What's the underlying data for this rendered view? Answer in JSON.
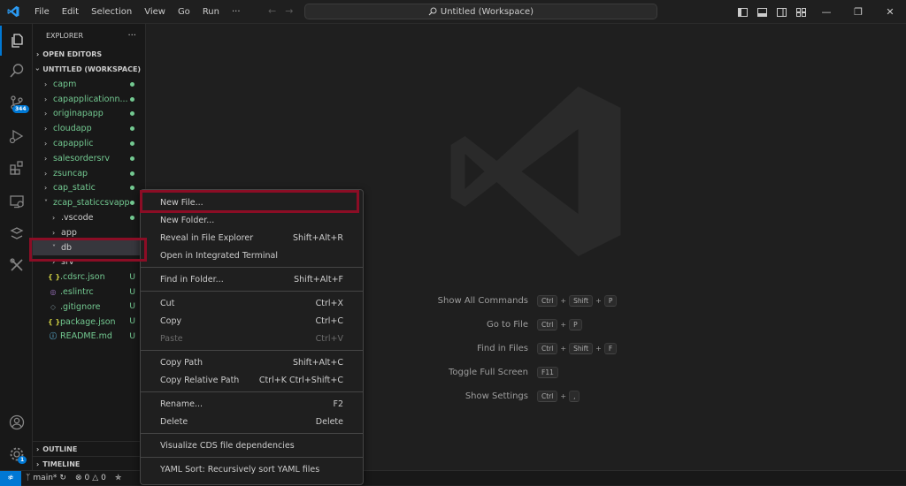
{
  "titlebar": {
    "menus": [
      "File",
      "Edit",
      "Selection",
      "View",
      "Go",
      "Run",
      "···"
    ],
    "command_center": "Untitled (Workspace)",
    "icons": [
      "toggle-primary-sidebar-icon",
      "toggle-panel-icon",
      "toggle-secondary-sidebar-icon",
      "customize-layout-icon"
    ]
  },
  "activitybar": {
    "items": [
      "explorer-icon",
      "search-icon",
      "source-control-icon",
      "run-debug-icon",
      "extensions-icon",
      "remote-explorer-icon",
      "sap-fiori-icon",
      "tools-icon"
    ],
    "scm_badge": "344",
    "account": "account-icon",
    "manage": "gear-icon",
    "manage_badge": "1"
  },
  "sidebar": {
    "title": "EXPLORER",
    "more": "···",
    "open_editors": "OPEN EDITORS",
    "workspace": "UNTITLED (WORKSPACE)",
    "folders": [
      "capm",
      "capapplicationn...",
      "originapapp",
      "cloudapp",
      "capapplic",
      "salesordersrv",
      "zsuncap",
      "cap_static",
      "zcap_staticcsvapp"
    ],
    "children": [
      {
        "name": ".vscode",
        "type": "folder"
      },
      {
        "name": "app",
        "type": "folder"
      },
      {
        "name": "db",
        "type": "folder-open"
      },
      {
        "name": "srv",
        "type": "folder"
      }
    ],
    "files": [
      {
        "name": ".cdsrc.json",
        "icon": "{ }",
        "status": "U"
      },
      {
        "name": ".eslintrc",
        "icon": "◎",
        "status": "U"
      },
      {
        "name": ".gitignore",
        "icon": "◇",
        "status": "U"
      },
      {
        "name": "package.json",
        "icon": "{ }",
        "status": "U"
      },
      {
        "name": "README.md",
        "icon": "ⓘ",
        "status": "U"
      }
    ],
    "outline": "OUTLINE",
    "timeline": "TIMELINE"
  },
  "editor": {
    "shortcuts": [
      {
        "label": "Show All Commands",
        "keys": [
          "Ctrl",
          "+",
          "Shift",
          "+",
          "P"
        ]
      },
      {
        "label": "Go to File",
        "keys": [
          "Ctrl",
          "+",
          "P"
        ]
      },
      {
        "label": "Find in Files",
        "keys": [
          "Ctrl",
          "+",
          "Shift",
          "+",
          "F"
        ]
      },
      {
        "label": "Toggle Full Screen",
        "keys": [
          "F11"
        ]
      },
      {
        "label": "Show Settings",
        "keys": [
          "Ctrl",
          "+",
          ","
        ]
      }
    ]
  },
  "context_menu": {
    "groups": [
      [
        {
          "label": "New File...",
          "key": ""
        },
        {
          "label": "New Folder...",
          "key": ""
        },
        {
          "label": "Reveal in File Explorer",
          "key": "Shift+Alt+R"
        },
        {
          "label": "Open in Integrated Terminal",
          "key": ""
        }
      ],
      [
        {
          "label": "Find in Folder...",
          "key": "Shift+Alt+F"
        }
      ],
      [
        {
          "label": "Cut",
          "key": "Ctrl+X"
        },
        {
          "label": "Copy",
          "key": "Ctrl+C"
        },
        {
          "label": "Paste",
          "key": "Ctrl+V",
          "disabled": true
        }
      ],
      [
        {
          "label": "Copy Path",
          "key": "Shift+Alt+C"
        },
        {
          "label": "Copy Relative Path",
          "key": "Ctrl+K Ctrl+Shift+C"
        }
      ],
      [
        {
          "label": "Rename...",
          "key": "F2"
        },
        {
          "label": "Delete",
          "key": "Delete"
        }
      ],
      [
        {
          "label": "Visualize CDS file dependencies",
          "key": ""
        }
      ],
      [
        {
          "label": "YAML Sort: Recursively sort YAML files",
          "key": ""
        }
      ]
    ]
  },
  "statusbar": {
    "branch": "main*",
    "errors": "0",
    "warnings": "0"
  },
  "colors": {
    "accent": "#0078d4",
    "git_untracked": "#73c991",
    "highlight_box": "#8b0d25"
  }
}
